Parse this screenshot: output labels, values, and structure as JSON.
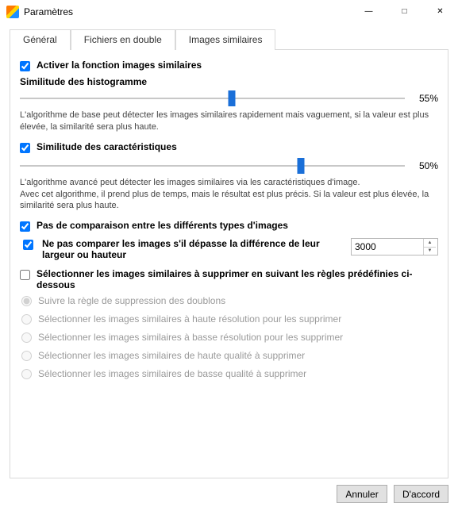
{
  "window": {
    "title": "Paramètres"
  },
  "tabs": {
    "general": "Général",
    "duplicates": "Fichiers en double",
    "similar": "Images similaires"
  },
  "similar": {
    "enable_label": "Activer la fonction images similaires",
    "histogram": {
      "title": "Similitude des histogramme",
      "value_text": "55%",
      "value_pct": 55,
      "help": "L'algorithme de base peut détecter les images similaires rapidement mais vaguement, si la valeur est plus élevée, la similarité sera plus haute."
    },
    "feature": {
      "checkbox_label": "Similitude des caractéristiques",
      "value_text": "50%",
      "value_pct": 50,
      "help": "L'algorithme avancé peut détecter les images similaires via les caractéristiques d'image.\nAvec cet algorithme, il prend plus de temps, mais le résultat est plus précis. Si la valeur est plus élevée, la similarité sera plus haute."
    },
    "no_cross_type_label": "Pas de comparaison entre les différents types d'images",
    "dim_diff": {
      "label": "Ne pas comparer les images s'il dépasse la différence de leur largeur ou hauteur",
      "value": "3000"
    },
    "select_rules": {
      "label": "Sélectionner les images similaires à supprimer en suivant les règles prédéfinies ci-dessous",
      "options": {
        "follow_dup": "Suivre la règle de suppression des doublons",
        "high_res": "Sélectionner les images similaires à haute résolution pour les supprimer",
        "low_res": "Sélectionner les images similaires à basse résolution pour les supprimer",
        "high_q": "Sélectionner les images similaires de haute qualité à supprimer",
        "low_q": "Sélectionner les images similaires de basse qualité à supprimer"
      }
    }
  },
  "footer": {
    "cancel": "Annuler",
    "ok": "D'accord"
  }
}
